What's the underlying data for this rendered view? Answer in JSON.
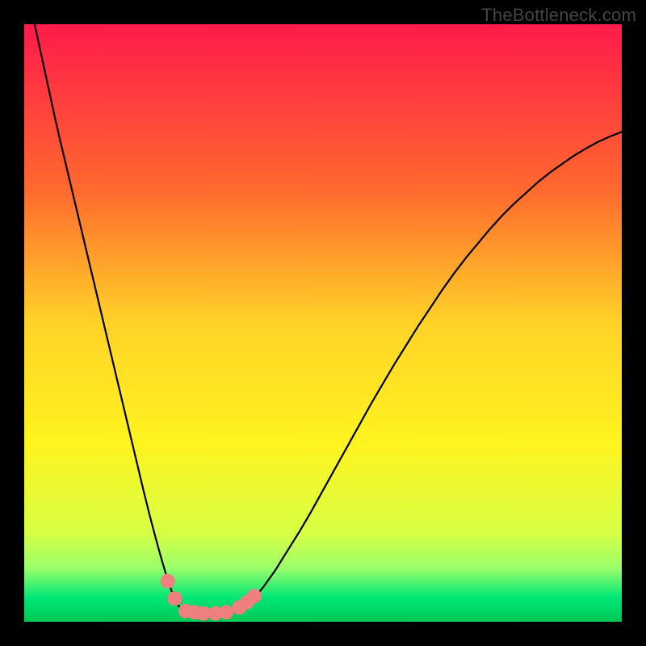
{
  "watermark": "TheBottleneck.com",
  "colors": {
    "frame": "#000000",
    "curve": "#000000",
    "marker_fill": "#f08080",
    "marker_stroke": "rgba(0,0,0,0)",
    "gradient_stops": [
      {
        "offset": 0.0,
        "color": "#ff1a4b"
      },
      {
        "offset": 0.28,
        "color": "#ff6a2e"
      },
      {
        "offset": 0.5,
        "color": "#ffd328"
      },
      {
        "offset": 0.7,
        "color": "#fff31e"
      },
      {
        "offset": 0.85,
        "color": "#d8ff44"
      },
      {
        "offset": 0.91,
        "color": "#9bff6a"
      },
      {
        "offset": 0.96,
        "color": "#00e676"
      },
      {
        "offset": 1.0,
        "color": "#00c853"
      }
    ]
  },
  "chart_data": {
    "type": "line",
    "title": "",
    "xlabel": "",
    "ylabel": "",
    "xlim": [
      0,
      1
    ],
    "ylim": [
      0,
      1
    ],
    "x": [
      0.0,
      0.01,
      0.02,
      0.03,
      0.04,
      0.05,
      0.06,
      0.07,
      0.08,
      0.09,
      0.1,
      0.11,
      0.12,
      0.13,
      0.14,
      0.15,
      0.16,
      0.17,
      0.18,
      0.19,
      0.2,
      0.21,
      0.22,
      0.23,
      0.24,
      0.25,
      0.252,
      0.254,
      0.256,
      0.258,
      0.26,
      0.265,
      0.27,
      0.275,
      0.28,
      0.285,
      0.29,
      0.3,
      0.31,
      0.32,
      0.335,
      0.35,
      0.36,
      0.37,
      0.38,
      0.39,
      0.4,
      0.42,
      0.44,
      0.46,
      0.48,
      0.5,
      0.52,
      0.54,
      0.56,
      0.58,
      0.6,
      0.62,
      0.64,
      0.66,
      0.68,
      0.7,
      0.72,
      0.74,
      0.76,
      0.78,
      0.8,
      0.82,
      0.84,
      0.86,
      0.88,
      0.9,
      0.92,
      0.94,
      0.96,
      0.98,
      1.0
    ],
    "values": [
      1.08,
      1.034,
      0.988,
      0.942,
      0.896,
      0.85,
      0.806,
      0.764,
      0.722,
      0.68,
      0.638,
      0.596,
      0.554,
      0.512,
      0.47,
      0.428,
      0.386,
      0.344,
      0.302,
      0.26,
      0.218,
      0.178,
      0.14,
      0.104,
      0.07,
      0.042,
      0.037,
      0.033,
      0.03,
      0.027,
      0.025,
      0.022,
      0.02,
      0.018,
      0.017,
      0.016,
      0.015,
      0.014,
      0.014,
      0.014,
      0.015,
      0.018,
      0.022,
      0.028,
      0.036,
      0.046,
      0.058,
      0.086,
      0.118,
      0.15,
      0.184,
      0.22,
      0.256,
      0.292,
      0.328,
      0.364,
      0.398,
      0.432,
      0.464,
      0.496,
      0.526,
      0.556,
      0.584,
      0.61,
      0.634,
      0.658,
      0.68,
      0.7,
      0.718,
      0.736,
      0.752,
      0.766,
      0.78,
      0.792,
      0.803,
      0.812,
      0.82
    ],
    "markers": [
      {
        "x": 0.24,
        "y": 0.068
      },
      {
        "x": 0.252,
        "y": 0.039
      },
      {
        "x": 0.27,
        "y": 0.018
      },
      {
        "x": 0.285,
        "y": 0.016
      },
      {
        "x": 0.3,
        "y": 0.014
      },
      {
        "x": 0.32,
        "y": 0.014
      },
      {
        "x": 0.338,
        "y": 0.016
      },
      {
        "x": 0.36,
        "y": 0.024
      },
      {
        "x": 0.373,
        "y": 0.033
      },
      {
        "x": 0.385,
        "y": 0.043
      }
    ],
    "marker_radius_px": 9
  }
}
